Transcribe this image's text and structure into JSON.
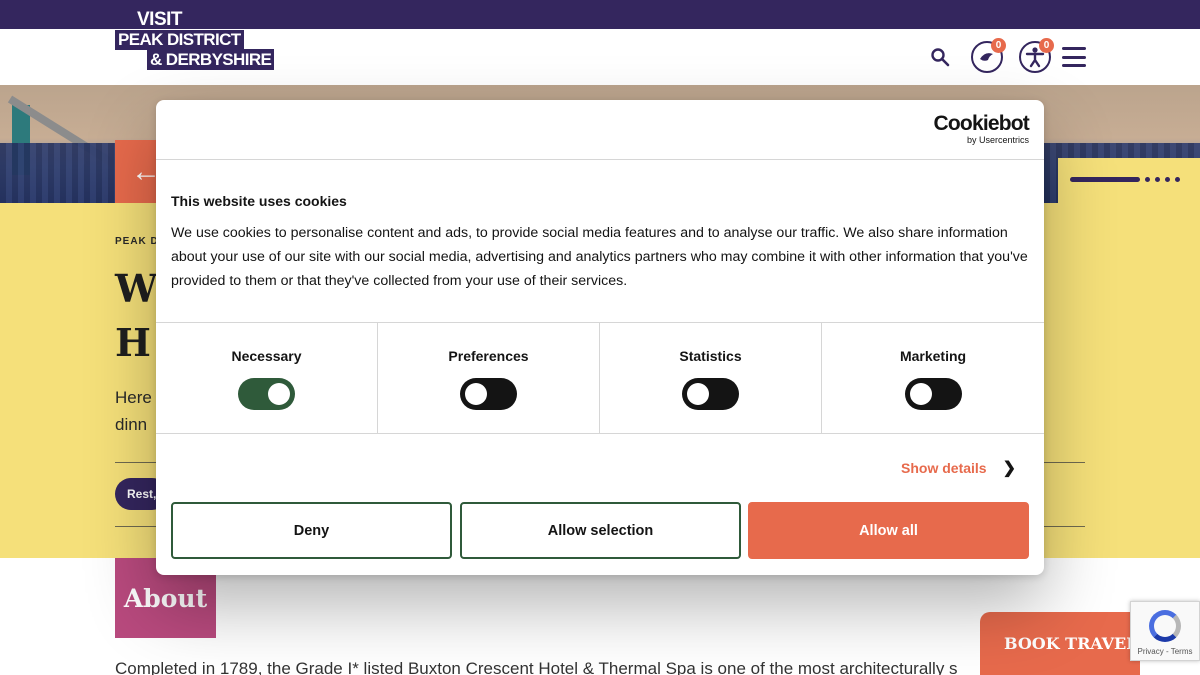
{
  "header": {
    "logo": {
      "line1": "VISIT",
      "line2": "PEAK DISTRICT",
      "line3": "& DERBYSHIRE"
    },
    "icons": [
      "search-icon",
      "accessibility-icon",
      "person-icon",
      "menu-icon"
    ],
    "accessibility_badge": "0",
    "person_badge": "0"
  },
  "hero": {
    "kicker": "PEAK D",
    "title_line1": "W",
    "title_line2": "H",
    "desc_line1": "Here",
    "desc_line2": "dinn",
    "pill": "Rest,",
    "back_arrow": "←"
  },
  "about": {
    "heading": "About",
    "body": "Completed in 1789, the Grade I* listed Buxton Crescent Hotel & Thermal Spa is one of the most architecturally s"
  },
  "book_travel": "BOOK TRAVEL",
  "recaptcha": {
    "text": "Privacy - Terms"
  },
  "cookie": {
    "brand": "Cookiebot",
    "brand_sub": "by Usercentrics",
    "title": "This website uses cookies",
    "text": "We use cookies to personalise content and ads, to provide social media features and to analyse our traffic. We also share information about your use of our site with our social media, advertising and analytics partners who may combine it with other information that you've provided to them or that they've collected from your use of their services.",
    "toggles": [
      {
        "label": "Necessary",
        "on": true
      },
      {
        "label": "Preferences",
        "on": false
      },
      {
        "label": "Statistics",
        "on": false
      },
      {
        "label": "Marketing",
        "on": false
      }
    ],
    "show_details": "Show details",
    "buttons": {
      "deny": "Deny",
      "allow_selection": "Allow selection",
      "allow_all": "Allow all"
    }
  },
  "colors": {
    "brand_purple": "#34265e",
    "accent_orange": "#e76a4c",
    "yellow": "#f5e07a",
    "toggle_green": "#2f5a3a",
    "about_pink": "#b94a7e"
  }
}
